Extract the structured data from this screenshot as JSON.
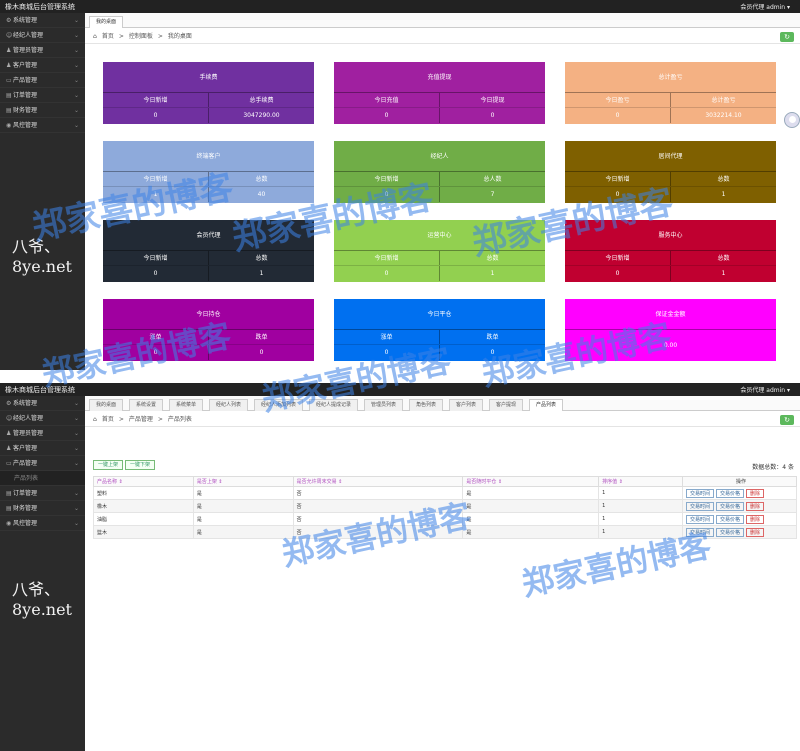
{
  "app": {
    "title": "橡木商城后台管理系统",
    "user": "会员代理 admin ▾"
  },
  "sidebar": [
    {
      "icon": "⚙",
      "label": "系统管理"
    },
    {
      "icon": "☺",
      "label": "经纪人管理"
    },
    {
      "icon": "♟",
      "label": "管理员管理"
    },
    {
      "icon": "♟",
      "label": "客户管理"
    },
    {
      "icon": "▭",
      "label": "产品管理"
    },
    {
      "icon": "▤",
      "label": "订单管理"
    },
    {
      "icon": "▤",
      "label": "财务管理"
    },
    {
      "icon": "◉",
      "label": "风控管理"
    }
  ],
  "sidebar_sub": "产品列表",
  "brand": "八爷、8ye.net",
  "s1": {
    "tab": "我的桌面",
    "crumb": [
      "首页",
      ">",
      "控制面板",
      ">",
      "我的桌面"
    ],
    "cards": [
      {
        "title": "手续费",
        "c1": "今日新增",
        "c2": "总手续费",
        "v1": "0",
        "v2": "3047290.00",
        "color": "#7030a0"
      },
      {
        "title": "充值提现",
        "c1": "今日充值",
        "c2": "今日提现",
        "v1": "0",
        "v2": "0",
        "color": "#a020a0"
      },
      {
        "title": "总计盈亏",
        "c1": "今日盈亏",
        "c2": "总计盈亏",
        "v1": "0",
        "v2": "3032214.10",
        "color": "#f4b183"
      },
      {
        "title": "终端客户",
        "c1": "今日新增",
        "c2": "总数",
        "v1": "1",
        "v2": "40",
        "color": "#8eaadb"
      },
      {
        "title": "经纪人",
        "c1": "今日新增",
        "c2": "总人数",
        "v1": "0",
        "v2": "7",
        "color": "#70ad47"
      },
      {
        "title": "居间代理",
        "c1": "今日新增",
        "c2": "总数",
        "v1": "0",
        "v2": "1",
        "color": "#7f6000"
      },
      {
        "title": "会员代理",
        "c1": "今日新增",
        "c2": "总数",
        "v1": "0",
        "v2": "1",
        "color": "#222a35"
      },
      {
        "title": "运营中心",
        "c1": "今日新增",
        "c2": "总数",
        "v1": "0",
        "v2": "1",
        "color": "#92d050"
      },
      {
        "title": "服务中心",
        "c1": "今日新增",
        "c2": "总数",
        "v1": "0",
        "v2": "1",
        "color": "#c00030"
      },
      {
        "title": "今日持仓",
        "c1": "涨单",
        "c2": "跌单",
        "v1": "0",
        "v2": "0",
        "color": "#a000a0"
      },
      {
        "title": "今日平仓",
        "c1": "涨单",
        "c2": "跌单",
        "v1": "0",
        "v2": "0",
        "color": "#0070f0"
      },
      {
        "title": "保证金金额",
        "single": "0.00",
        "color": "#ff00ff"
      }
    ]
  },
  "s2": {
    "tabs": [
      "我的桌面",
      "系统设置",
      "系统菜单",
      "经纪人列表",
      "经纪人添加列表",
      "经纪人提成记录",
      "管理员列表",
      "角色列表",
      "客户列表",
      "客户提现",
      "产品列表"
    ],
    "crumb": [
      "首页",
      ">",
      "产品管理",
      ">",
      "产品列表"
    ],
    "btn_up": "一键上架",
    "btn_down": "一键下架",
    "total": "数据总数：4 条",
    "headers": [
      "产品名称 ⇕",
      "是否上架 ⇕",
      "是否允许周末交易 ⇕",
      "是否随时平仓 ⇕",
      "排序值 ⇕",
      "操作"
    ],
    "rows": [
      [
        "塑料",
        "是",
        "否",
        "是",
        "1"
      ],
      [
        "橡木",
        "是",
        "否",
        "是",
        "1"
      ],
      [
        "油脂",
        "是",
        "否",
        "是",
        "1"
      ],
      [
        "篮木",
        "是",
        "否",
        "是",
        "1"
      ]
    ],
    "ops": [
      "交易时间",
      "交易价格",
      "删除"
    ]
  },
  "watermarks": [
    "郑家喜的博客",
    "郑家喜的博客",
    "郑家喜的博客",
    "郑家喜的博客",
    "郑家喜的博客",
    "郑家喜的博客",
    "郑家喜的博客",
    "郑家喜的博客"
  ]
}
